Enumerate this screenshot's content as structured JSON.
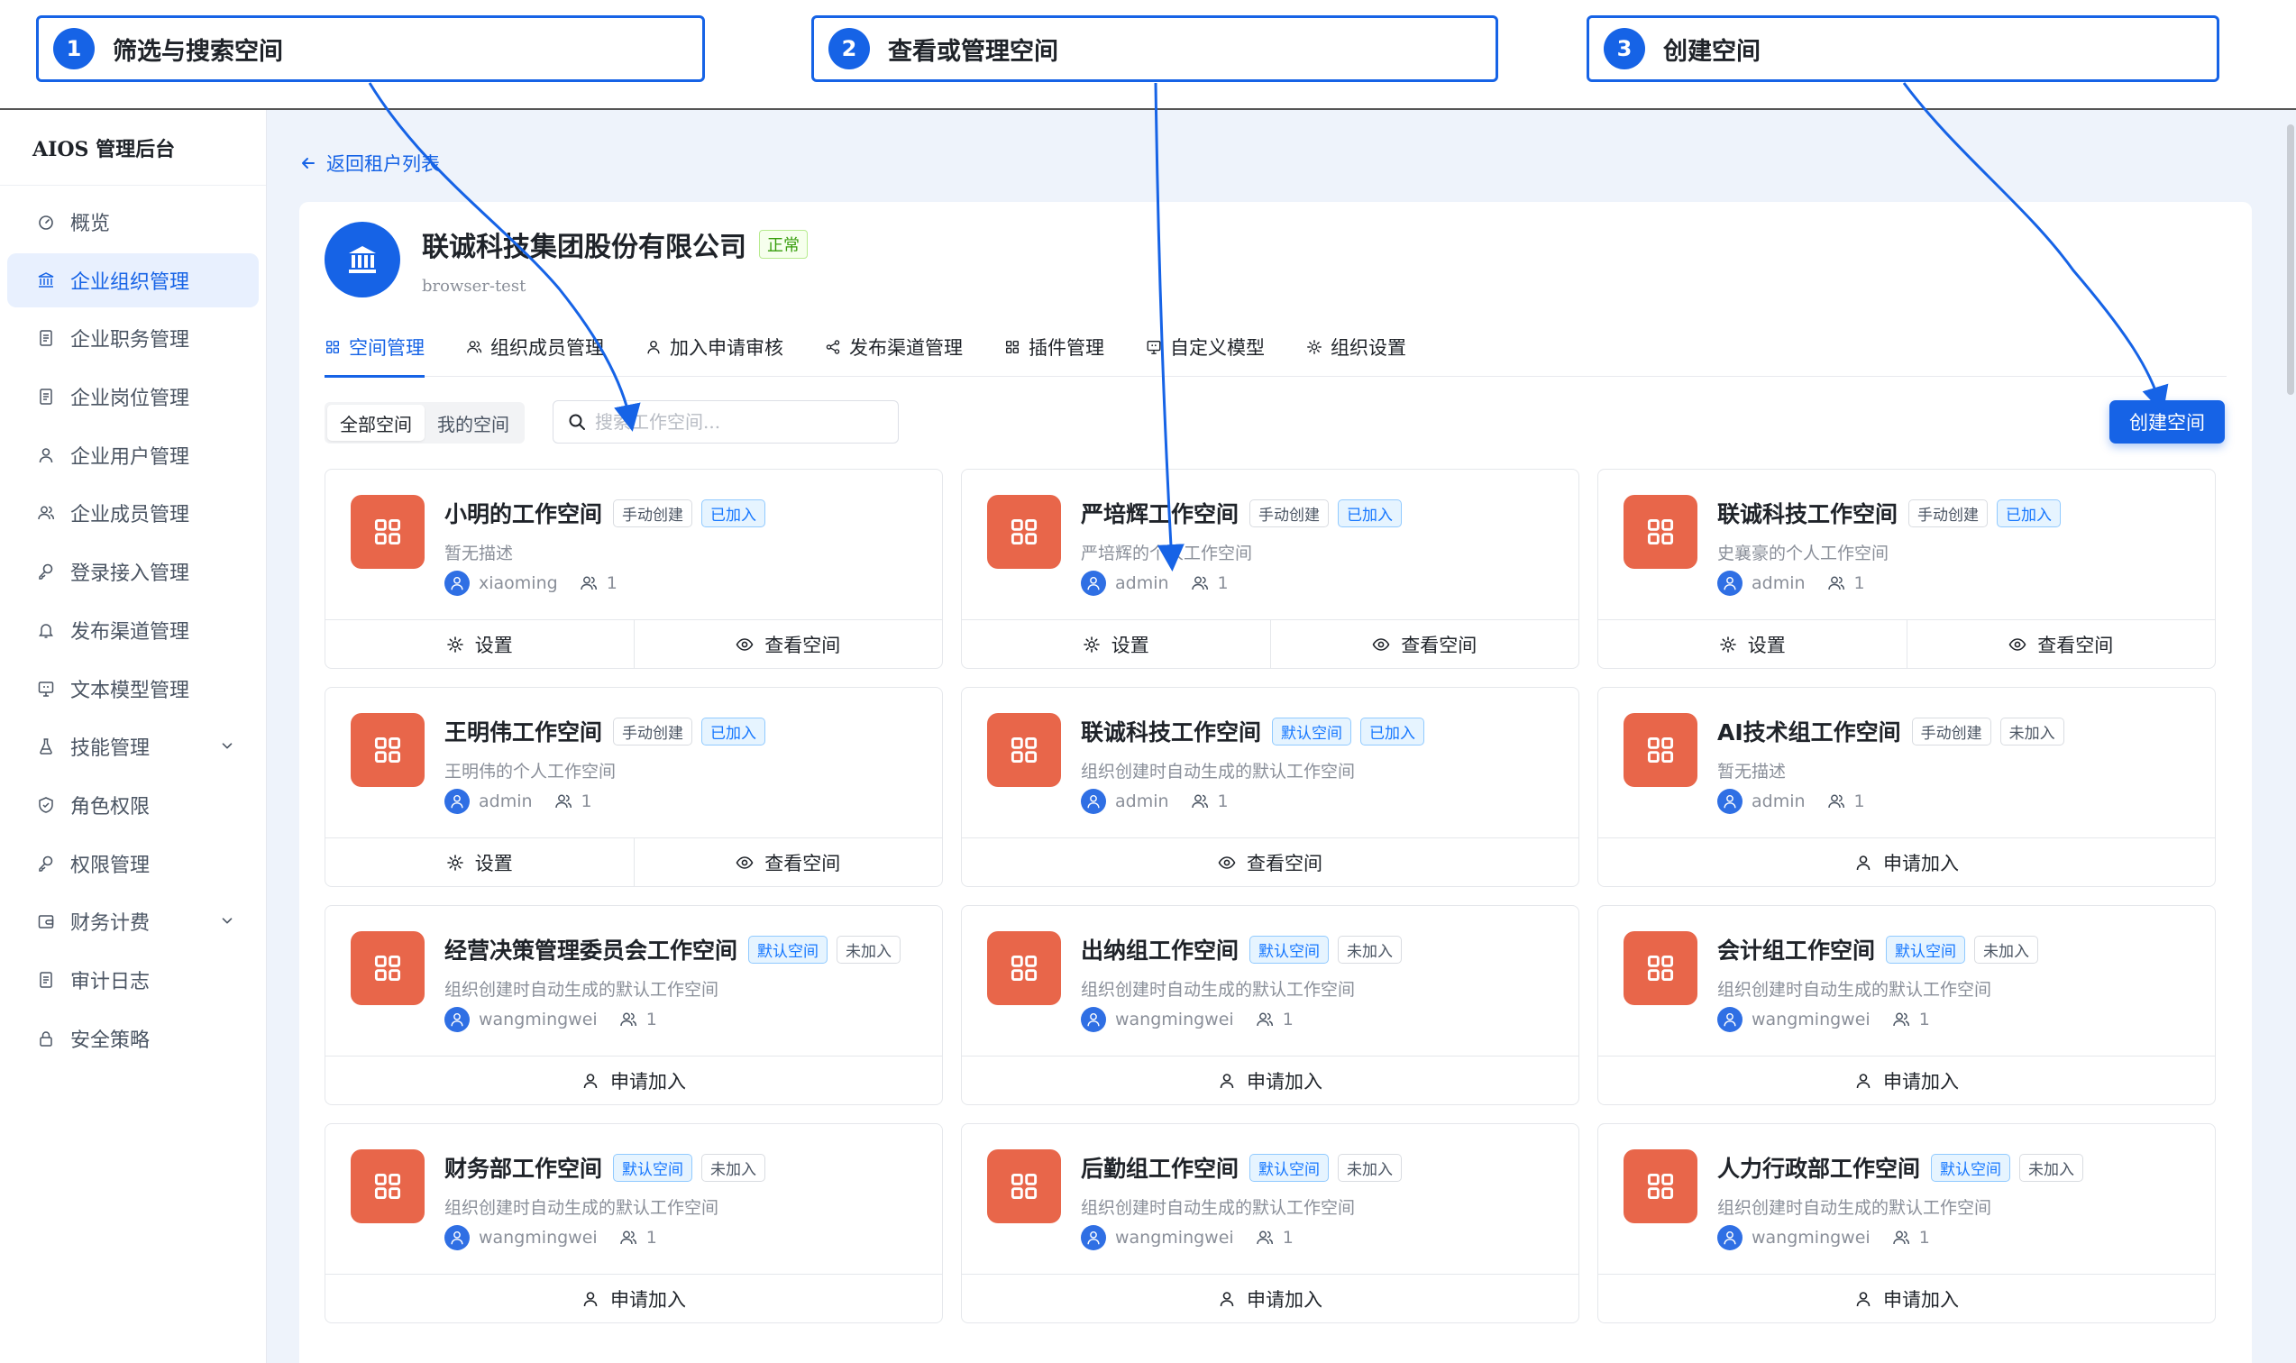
{
  "callouts": [
    {
      "num": "1",
      "text": "筛选与搜索空间"
    },
    {
      "num": "2",
      "text": "查看或管理空间"
    },
    {
      "num": "3",
      "text": "创建空间"
    }
  ],
  "app": {
    "brand": "AIOS 管理后台"
  },
  "sidebar": {
    "items": [
      {
        "label": "概览",
        "icon": "dashboard-icon"
      },
      {
        "label": "企业组织管理",
        "icon": "bank-icon",
        "active": true
      },
      {
        "label": "企业职务管理",
        "icon": "document-icon"
      },
      {
        "label": "企业岗位管理",
        "icon": "document-icon"
      },
      {
        "label": "企业用户管理",
        "icon": "user-icon"
      },
      {
        "label": "企业成员管理",
        "icon": "users-icon"
      },
      {
        "label": "登录接入管理",
        "icon": "key-icon"
      },
      {
        "label": "发布渠道管理",
        "icon": "bell-icon"
      },
      {
        "label": "文本模型管理",
        "icon": "monitor-icon"
      },
      {
        "label": "技能管理",
        "icon": "flask-icon",
        "expandable": true
      },
      {
        "label": "角色权限",
        "icon": "shield-icon"
      },
      {
        "label": "权限管理",
        "icon": "key-icon"
      },
      {
        "label": "财务计费",
        "icon": "wallet-icon",
        "expandable": true
      },
      {
        "label": "审计日志",
        "icon": "document-icon"
      },
      {
        "label": "安全策略",
        "icon": "lock-icon"
      }
    ]
  },
  "main": {
    "back_label": "返回租户列表",
    "org": {
      "name": "联诚科技集团股份有限公司",
      "status": "正常",
      "code": "browser-test"
    },
    "tabs": [
      {
        "label": "空间管理",
        "icon": "grid-icon",
        "active": true
      },
      {
        "label": "组织成员管理",
        "icon": "users-icon"
      },
      {
        "label": "加入申请审核",
        "icon": "user-icon"
      },
      {
        "label": "发布渠道管理",
        "icon": "share-icon"
      },
      {
        "label": "插件管理",
        "icon": "grid-icon"
      },
      {
        "label": "自定义模型",
        "icon": "monitor-icon"
      },
      {
        "label": "组织设置",
        "icon": "gear-icon"
      }
    ],
    "filter": {
      "all": "全部空间",
      "mine": "我的空间"
    },
    "search": {
      "placeholder": "搜索工作空间..."
    },
    "create_label": "创建空间",
    "actions": {
      "settings": "设置",
      "view": "查看空间",
      "apply": "申请加入"
    },
    "workspaces": [
      {
        "name": "小明的工作空间",
        "type": "手动创建",
        "type_style": "gray",
        "state": "已加入",
        "state_style": "blue",
        "desc": "暂无描述",
        "owner": "xiaoming",
        "members": "1",
        "joined": true
      },
      {
        "name": "严培辉工作空间",
        "type": "手动创建",
        "type_style": "gray",
        "state": "已加入",
        "state_style": "blue",
        "desc": "严培辉的个人工作空间",
        "owner": "admin",
        "members": "1",
        "joined": true
      },
      {
        "name": "联诚科技工作空间",
        "type": "手动创建",
        "type_style": "gray",
        "state": "已加入",
        "state_style": "blue",
        "desc": "史襄豪的个人工作空间",
        "owner": "admin",
        "members": "1",
        "joined": true
      },
      {
        "name": "王明伟工作空间",
        "type": "手动创建",
        "type_style": "gray",
        "state": "已加入",
        "state_style": "blue",
        "desc": "王明伟的个人工作空间",
        "owner": "admin",
        "members": "1",
        "joined": true
      },
      {
        "name": "联诚科技工作空间",
        "type": "默认空间",
        "type_style": "blue",
        "state": "已加入",
        "state_style": "blue",
        "desc": "组织创建时自动生成的默认工作空间",
        "owner": "admin",
        "members": "1",
        "joined": true,
        "view_only": true
      },
      {
        "name": "AI技术组工作空间",
        "type": "手动创建",
        "type_style": "gray",
        "state": "未加入",
        "state_style": "gray",
        "desc": "暂无描述",
        "owner": "admin",
        "members": "1",
        "joined": false
      },
      {
        "name": "经营决策管理委员会工作空间",
        "type": "默认空间",
        "type_style": "blue",
        "state": "未加入",
        "state_style": "gray",
        "desc": "组织创建时自动生成的默认工作空间",
        "owner": "wangmingwei",
        "members": "1",
        "joined": false
      },
      {
        "name": "出纳组工作空间",
        "type": "默认空间",
        "type_style": "blue",
        "state": "未加入",
        "state_style": "gray",
        "desc": "组织创建时自动生成的默认工作空间",
        "owner": "wangmingwei",
        "members": "1",
        "joined": false
      },
      {
        "name": "会计组工作空间",
        "type": "默认空间",
        "type_style": "blue",
        "state": "未加入",
        "state_style": "gray",
        "desc": "组织创建时自动生成的默认工作空间",
        "owner": "wangmingwei",
        "members": "1",
        "joined": false
      },
      {
        "name": "财务部工作空间",
        "type": "默认空间",
        "type_style": "blue",
        "state": "未加入",
        "state_style": "gray",
        "desc": "组织创建时自动生成的默认工作空间",
        "owner": "wangmingwei",
        "members": "1",
        "joined": false
      },
      {
        "name": "后勤组工作空间",
        "type": "默认空间",
        "type_style": "blue",
        "state": "未加入",
        "state_style": "gray",
        "desc": "组织创建时自动生成的默认工作空间",
        "owner": "wangmingwei",
        "members": "1",
        "joined": false
      },
      {
        "name": "人力行政部工作空间",
        "type": "默认空间",
        "type_style": "blue",
        "state": "未加入",
        "state_style": "gray",
        "desc": "组织创建时自动生成的默认工作空间",
        "owner": "wangmingwei",
        "members": "1",
        "joined": false
      }
    ]
  },
  "colors": {
    "accent": "#1663e6",
    "workspace_icon": "#e8664a",
    "status_ok": "#389e0d"
  }
}
